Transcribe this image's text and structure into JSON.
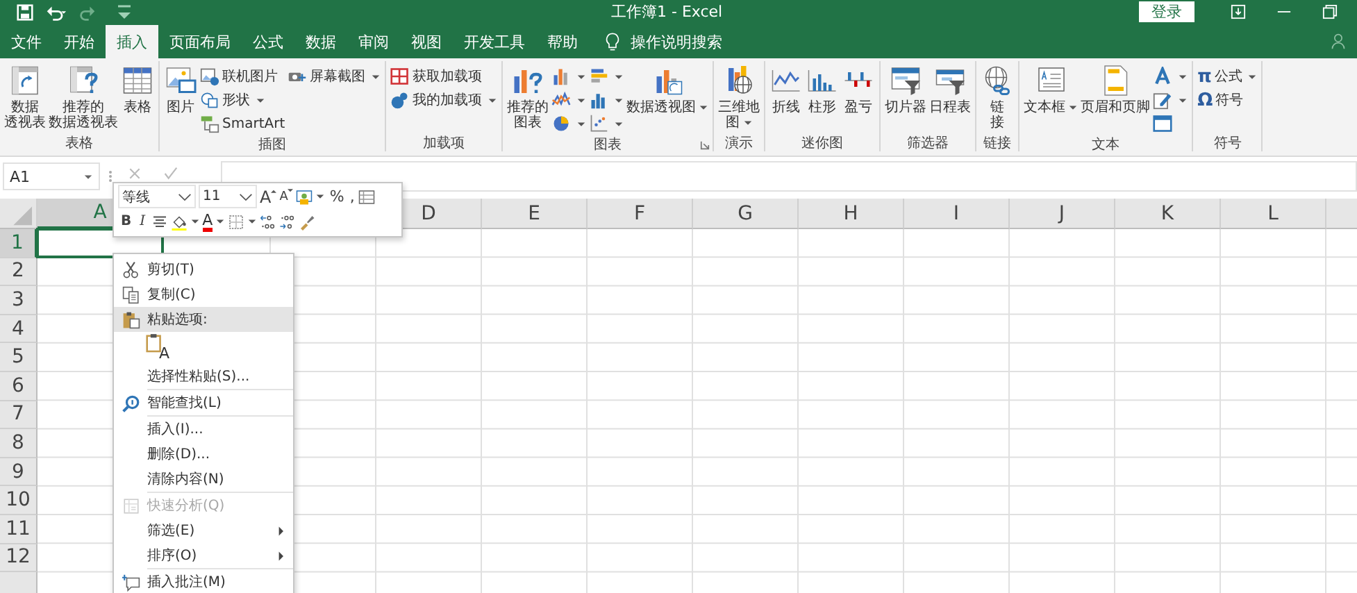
{
  "title_bar": {
    "title": "工作簿1 - Excel",
    "login": "登录"
  },
  "tabs": [
    {
      "label": "文件",
      "selected": false
    },
    {
      "label": "开始",
      "selected": false
    },
    {
      "label": "插入",
      "selected": true
    },
    {
      "label": "页面布局",
      "selected": false
    },
    {
      "label": "公式",
      "selected": false
    },
    {
      "label": "数据",
      "selected": false
    },
    {
      "label": "审阅",
      "selected": false
    },
    {
      "label": "视图",
      "selected": false
    },
    {
      "label": "开发工具",
      "selected": false
    },
    {
      "label": "帮助",
      "selected": false
    }
  ],
  "tell_me": "操作说明搜索",
  "ribbon": [
    {
      "label": "表格",
      "launcher": false,
      "items": [
        {
          "kind": "large",
          "lines": [
            "数据",
            "透视表"
          ]
        },
        {
          "kind": "large",
          "lines": [
            "推荐的",
            "数据透视表"
          ]
        },
        {
          "kind": "large",
          "lines": [
            "表格"
          ]
        }
      ]
    },
    {
      "label": "插图",
      "launcher": false,
      "items": [
        {
          "kind": "large",
          "lines": [
            "图片"
          ]
        },
        {
          "kind": "stack",
          "items": [
            {
              "label": "联机图片",
              "dropdown": false
            },
            {
              "label": "形状",
              "dropdown": true
            },
            {
              "label": "SmartArt",
              "dropdown": false
            }
          ]
        },
        {
          "kind": "stack",
          "items": [
            {
              "label": "屏幕截图",
              "dropdown": true
            }
          ]
        }
      ]
    },
    {
      "label": "加载项",
      "launcher": false,
      "items": [
        {
          "kind": "stack",
          "items": [
            {
              "label": "获取加载项",
              "dropdown": false
            },
            {
              "label": "我的加载项",
              "dropdown": true
            }
          ]
        }
      ]
    },
    {
      "label": "图表",
      "launcher": true,
      "items": [
        {
          "kind": "large",
          "lines": [
            "推荐的",
            "图表"
          ]
        },
        {
          "kind": "stack",
          "items": [
            {
              "dropdown": true
            },
            {
              "dropdown": true
            },
            {
              "dropdown": true
            }
          ]
        },
        {
          "kind": "stack",
          "items": [
            {
              "dropdown": true
            },
            {
              "dropdown": true
            },
            {
              "dropdown": true
            }
          ]
        },
        {
          "kind": "large",
          "lines": [
            "数据透视图"
          ],
          "dropdown": true
        }
      ]
    },
    {
      "label": "演示",
      "launcher": false,
      "items": [
        {
          "kind": "large",
          "lines": [
            "三维地",
            "图"
          ],
          "dropdown": true
        }
      ]
    },
    {
      "label": "迷你图",
      "launcher": false,
      "items": [
        {
          "kind": "large",
          "lines": [
            "折线"
          ]
        },
        {
          "kind": "large",
          "lines": [
            "柱形"
          ]
        },
        {
          "kind": "large",
          "lines": [
            "盈亏"
          ]
        }
      ]
    },
    {
      "label": "筛选器",
      "launcher": false,
      "items": [
        {
          "kind": "large",
          "lines": [
            "切片器"
          ]
        },
        {
          "kind": "large",
          "lines": [
            "日程表"
          ]
        }
      ]
    },
    {
      "label": "链接",
      "launcher": false,
      "items": [
        {
          "kind": "large",
          "lines": [
            "链",
            "接"
          ]
        }
      ]
    },
    {
      "label": "文本",
      "launcher": false,
      "items": [
        {
          "kind": "large",
          "lines": [
            "文本框"
          ],
          "dropdown": true
        },
        {
          "kind": "large",
          "lines": [
            "页眉和页脚"
          ]
        },
        {
          "kind": "stack",
          "items": [
            {
              "dropdown": true
            },
            {
              "dropdown": true
            },
            {
              "dropdown": false
            }
          ]
        }
      ]
    },
    {
      "label": "符号",
      "launcher": false,
      "items": [
        {
          "kind": "stack",
          "items": [
            {
              "glyph": "π",
              "label": "公式",
              "dropdown": true
            },
            {
              "glyph": "Ω",
              "label": "符号",
              "dropdown": false
            }
          ]
        }
      ]
    }
  ],
  "sheet": {
    "name_box": "A1",
    "columns": [
      {
        "kind": "header",
        "label": "A",
        "selected": true
      },
      {
        "kind": "covered"
      },
      {
        "kind": "covered"
      },
      {
        "kind": "header",
        "label": "D",
        "selected": false
      },
      {
        "kind": "header",
        "label": "E",
        "selected": false
      },
      {
        "kind": "header",
        "label": "F",
        "selected": false
      },
      {
        "kind": "header",
        "label": "G",
        "selected": false
      },
      {
        "kind": "header",
        "label": "H",
        "selected": false
      },
      {
        "kind": "header",
        "label": "I",
        "selected": false
      },
      {
        "kind": "header",
        "label": "J",
        "selected": false
      },
      {
        "kind": "header",
        "label": "K",
        "selected": false
      },
      {
        "kind": "header",
        "label": "L",
        "selected": false
      }
    ],
    "rows": [
      {
        "label": "1",
        "selected": true
      },
      {
        "label": "2",
        "selected": false
      },
      {
        "label": "3",
        "selected": false
      },
      {
        "label": "4",
        "selected": false
      },
      {
        "label": "5",
        "selected": false
      },
      {
        "label": "6",
        "selected": false
      },
      {
        "label": "7",
        "selected": false
      },
      {
        "label": "8",
        "selected": false
      },
      {
        "label": "9",
        "selected": false
      },
      {
        "label": "10",
        "selected": false
      },
      {
        "label": "11",
        "selected": false
      },
      {
        "label": "12",
        "selected": false
      }
    ]
  },
  "mini_toolbar": {
    "font": "等线",
    "size": "11",
    "top": [
      {
        "kind": "grow",
        "label": "A"
      },
      {
        "kind": "shrink",
        "label": "A"
      },
      {
        "kind": "format",
        "dropdown": true
      },
      {
        "kind": "text",
        "label": "%"
      },
      {
        "kind": "text",
        "label": ","
      },
      {
        "kind": "table",
        "dropdown": false
      }
    ],
    "bottom": [
      {
        "kind": "bold",
        "label": "B"
      },
      {
        "kind": "italic",
        "label": "I"
      },
      {
        "kind": "align",
        "dropdown": false
      },
      {
        "kind": "fill",
        "dropdown": true
      },
      {
        "kind": "fontcolor",
        "label": "A",
        "dropdown": true
      },
      {
        "kind": "borders",
        "dropdown": true
      },
      {
        "kind": "incdec",
        "dropdown": false
      },
      {
        "kind": "decdec",
        "dropdown": false
      },
      {
        "kind": "brush",
        "dropdown": false
      }
    ]
  },
  "context_menu": [
    {
      "kind": "item",
      "label": "剪切(T)",
      "selected": false,
      "disabled": false,
      "submenu": false
    },
    {
      "kind": "item",
      "label": "复制(C)",
      "selected": false,
      "disabled": false,
      "submenu": false
    },
    {
      "kind": "header",
      "label": "粘贴选项:",
      "selected": true,
      "disabled": false,
      "submenu": false
    },
    {
      "kind": "paste_options",
      "label": "A"
    },
    {
      "kind": "item",
      "label": "选择性粘贴(S)...",
      "selected": false,
      "disabled": false,
      "submenu": false
    },
    {
      "kind": "separator"
    },
    {
      "kind": "item",
      "label": "智能查找(L)",
      "selected": false,
      "disabled": false,
      "submenu": false
    },
    {
      "kind": "separator"
    },
    {
      "kind": "item",
      "label": "插入(I)...",
      "selected": false,
      "disabled": false,
      "submenu": false
    },
    {
      "kind": "item",
      "label": "删除(D)...",
      "selected": false,
      "disabled": false,
      "submenu": false
    },
    {
      "kind": "item",
      "label": "清除内容(N)",
      "selected": false,
      "disabled": false,
      "submenu": false
    },
    {
      "kind": "separator"
    },
    {
      "kind": "item",
      "label": "快速分析(Q)",
      "selected": false,
      "disabled": true,
      "submenu": false
    },
    {
      "kind": "item",
      "label": "筛选(E)",
      "selected": false,
      "disabled": false,
      "submenu": true
    },
    {
      "kind": "item",
      "label": "排序(O)",
      "selected": false,
      "disabled": false,
      "submenu": true
    },
    {
      "kind": "separator"
    },
    {
      "kind": "item",
      "label": "插入批注(M)",
      "selected": false,
      "disabled": false,
      "submenu": false
    }
  ]
}
